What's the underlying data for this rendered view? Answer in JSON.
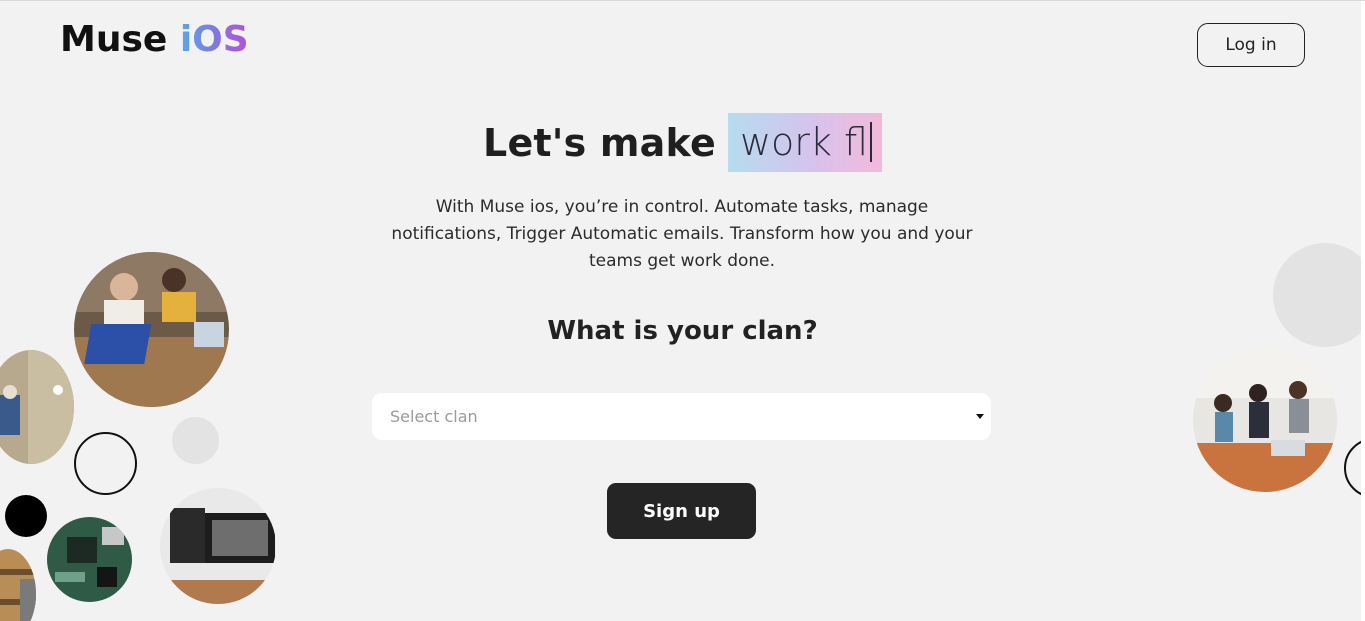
{
  "header": {
    "logo_main": "Muse ",
    "logo_accent": "iOS",
    "login_label": "Log in"
  },
  "hero": {
    "static_text": "Let's make",
    "typed_text": "work fl"
  },
  "subtitle": "With Muse ios, you’re in control. Automate tasks, manage notifications, Trigger Automatic emails. Transform how you and your teams get work done.",
  "form": {
    "heading": "What is your clan?",
    "select_placeholder": "Select clan",
    "signup_label": "Sign up"
  },
  "colors": {
    "background": "#f2f2f2",
    "button_dark": "#252525",
    "logo_gradient": [
      "#5aa9e6",
      "#7a7ee0",
      "#b84fd6"
    ],
    "highlight_gradient": [
      "#b5dcef",
      "#d6c3ec",
      "#f3b9da"
    ]
  }
}
